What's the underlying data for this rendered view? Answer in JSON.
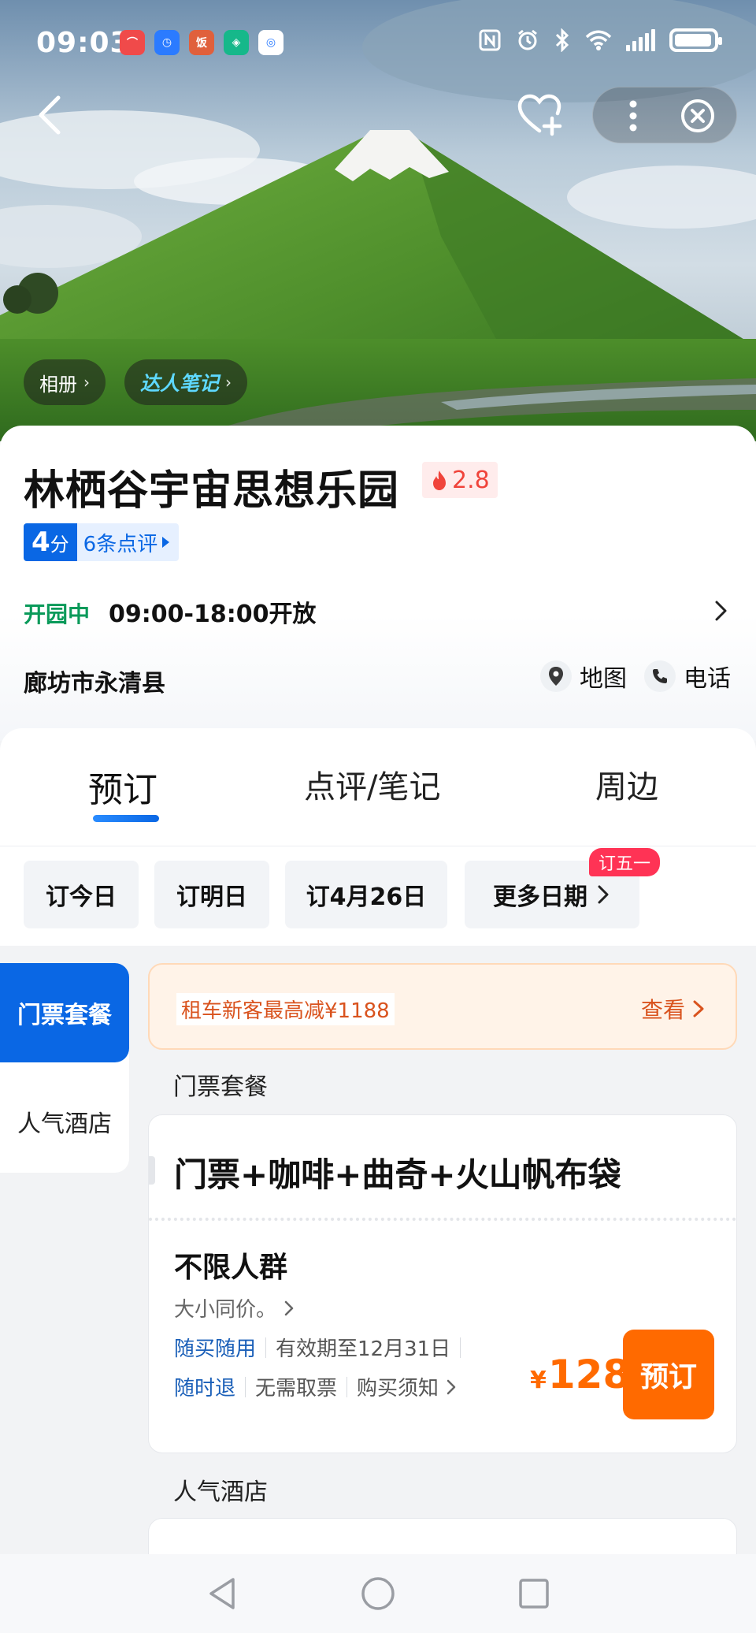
{
  "status_bar": {
    "time": "09:03",
    "app_icons": [
      {
        "name": "red-app-icon",
        "color": "#f04a4a",
        "glyph": "⌒"
      },
      {
        "name": "blue-clock-app-icon",
        "color": "#2b7bff",
        "glyph": "◷"
      },
      {
        "name": "food-app-icon",
        "color": "#e0603c",
        "glyph": "饭"
      },
      {
        "name": "green-shield-app-icon",
        "color": "#16b88a",
        "glyph": "◈"
      },
      {
        "name": "white-circle-app-icon",
        "color": "#ffffff",
        "glyph": "◎"
      }
    ],
    "battery_level": 0.86
  },
  "hero": {
    "album_label": "相册",
    "notes_label": "达人笔记",
    "colors": {
      "sky": "#b7cadb",
      "grass": "#3f7a2a",
      "snow": "#f2f2f2"
    }
  },
  "attraction": {
    "name": "林栖谷宇宙思想乐园",
    "heat": "2.8",
    "score": "4",
    "score_unit": "分",
    "review_count": "6条点评",
    "open_status": "开园中",
    "open_hours": "09:00-18:00开放",
    "address": "廊坊市永清县",
    "map_label": "地图",
    "phone_label": "电话"
  },
  "tabs": [
    {
      "label": "预订",
      "active": true
    },
    {
      "label": "点评/笔记",
      "active": false
    },
    {
      "label": "周边",
      "active": false
    }
  ],
  "dates": {
    "today": "订今日",
    "tomorrow": "订明日",
    "specific": "订4月26日",
    "more": "更多日期",
    "badge": "订五一"
  },
  "side_nav": {
    "tickets": "门票套餐",
    "hotels": "人气酒店"
  },
  "promo": {
    "text": "租车新客最高减¥1188",
    "link": "查看"
  },
  "sections": {
    "tickets": "门票套餐",
    "hotels": "人气酒店"
  },
  "ticket": {
    "title": "门票+咖啡+曲奇+火山帆布袋",
    "audience": "不限人群",
    "note": "大小同价。",
    "tag_anytime": "随买随用",
    "validity": "有效期至12月31日",
    "tag_refund": "随时退",
    "no_pickup": "无需取票",
    "purchase_notes": "购买须知",
    "currency": "¥",
    "price": "128",
    "book_label": "预订"
  },
  "accent_colors": {
    "primary_blue": "#0a67e4",
    "orange": "#ff6a00",
    "green": "#0a9a5a",
    "red": "#f0443b"
  }
}
